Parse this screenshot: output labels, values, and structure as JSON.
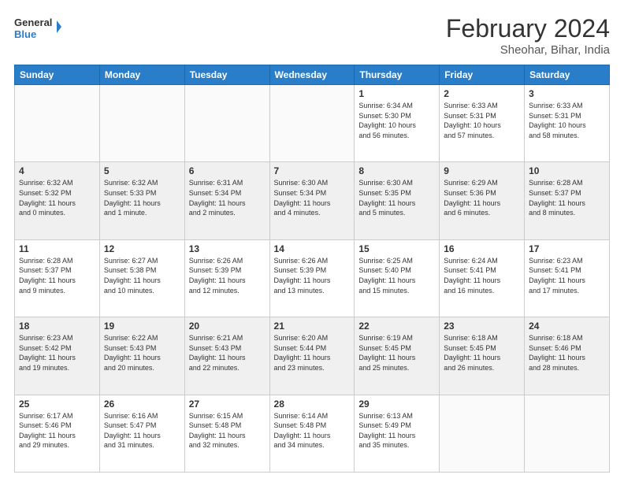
{
  "header": {
    "logo_line1": "General",
    "logo_line2": "Blue",
    "title": "February 2024",
    "subtitle": "Sheohar, Bihar, India"
  },
  "days_of_week": [
    "Sunday",
    "Monday",
    "Tuesday",
    "Wednesday",
    "Thursday",
    "Friday",
    "Saturday"
  ],
  "weeks": [
    [
      {
        "num": "",
        "info": ""
      },
      {
        "num": "",
        "info": ""
      },
      {
        "num": "",
        "info": ""
      },
      {
        "num": "",
        "info": ""
      },
      {
        "num": "1",
        "info": "Sunrise: 6:34 AM\nSunset: 5:30 PM\nDaylight: 10 hours\nand 56 minutes."
      },
      {
        "num": "2",
        "info": "Sunrise: 6:33 AM\nSunset: 5:31 PM\nDaylight: 10 hours\nand 57 minutes."
      },
      {
        "num": "3",
        "info": "Sunrise: 6:33 AM\nSunset: 5:31 PM\nDaylight: 10 hours\nand 58 minutes."
      }
    ],
    [
      {
        "num": "4",
        "info": "Sunrise: 6:32 AM\nSunset: 5:32 PM\nDaylight: 11 hours\nand 0 minutes."
      },
      {
        "num": "5",
        "info": "Sunrise: 6:32 AM\nSunset: 5:33 PM\nDaylight: 11 hours\nand 1 minute."
      },
      {
        "num": "6",
        "info": "Sunrise: 6:31 AM\nSunset: 5:34 PM\nDaylight: 11 hours\nand 2 minutes."
      },
      {
        "num": "7",
        "info": "Sunrise: 6:30 AM\nSunset: 5:34 PM\nDaylight: 11 hours\nand 4 minutes."
      },
      {
        "num": "8",
        "info": "Sunrise: 6:30 AM\nSunset: 5:35 PM\nDaylight: 11 hours\nand 5 minutes."
      },
      {
        "num": "9",
        "info": "Sunrise: 6:29 AM\nSunset: 5:36 PM\nDaylight: 11 hours\nand 6 minutes."
      },
      {
        "num": "10",
        "info": "Sunrise: 6:28 AM\nSunset: 5:37 PM\nDaylight: 11 hours\nand 8 minutes."
      }
    ],
    [
      {
        "num": "11",
        "info": "Sunrise: 6:28 AM\nSunset: 5:37 PM\nDaylight: 11 hours\nand 9 minutes."
      },
      {
        "num": "12",
        "info": "Sunrise: 6:27 AM\nSunset: 5:38 PM\nDaylight: 11 hours\nand 10 minutes."
      },
      {
        "num": "13",
        "info": "Sunrise: 6:26 AM\nSunset: 5:39 PM\nDaylight: 11 hours\nand 12 minutes."
      },
      {
        "num": "14",
        "info": "Sunrise: 6:26 AM\nSunset: 5:39 PM\nDaylight: 11 hours\nand 13 minutes."
      },
      {
        "num": "15",
        "info": "Sunrise: 6:25 AM\nSunset: 5:40 PM\nDaylight: 11 hours\nand 15 minutes."
      },
      {
        "num": "16",
        "info": "Sunrise: 6:24 AM\nSunset: 5:41 PM\nDaylight: 11 hours\nand 16 minutes."
      },
      {
        "num": "17",
        "info": "Sunrise: 6:23 AM\nSunset: 5:41 PM\nDaylight: 11 hours\nand 17 minutes."
      }
    ],
    [
      {
        "num": "18",
        "info": "Sunrise: 6:23 AM\nSunset: 5:42 PM\nDaylight: 11 hours\nand 19 minutes."
      },
      {
        "num": "19",
        "info": "Sunrise: 6:22 AM\nSunset: 5:43 PM\nDaylight: 11 hours\nand 20 minutes."
      },
      {
        "num": "20",
        "info": "Sunrise: 6:21 AM\nSunset: 5:43 PM\nDaylight: 11 hours\nand 22 minutes."
      },
      {
        "num": "21",
        "info": "Sunrise: 6:20 AM\nSunset: 5:44 PM\nDaylight: 11 hours\nand 23 minutes."
      },
      {
        "num": "22",
        "info": "Sunrise: 6:19 AM\nSunset: 5:45 PM\nDaylight: 11 hours\nand 25 minutes."
      },
      {
        "num": "23",
        "info": "Sunrise: 6:18 AM\nSunset: 5:45 PM\nDaylight: 11 hours\nand 26 minutes."
      },
      {
        "num": "24",
        "info": "Sunrise: 6:18 AM\nSunset: 5:46 PM\nDaylight: 11 hours\nand 28 minutes."
      }
    ],
    [
      {
        "num": "25",
        "info": "Sunrise: 6:17 AM\nSunset: 5:46 PM\nDaylight: 11 hours\nand 29 minutes."
      },
      {
        "num": "26",
        "info": "Sunrise: 6:16 AM\nSunset: 5:47 PM\nDaylight: 11 hours\nand 31 minutes."
      },
      {
        "num": "27",
        "info": "Sunrise: 6:15 AM\nSunset: 5:48 PM\nDaylight: 11 hours\nand 32 minutes."
      },
      {
        "num": "28",
        "info": "Sunrise: 6:14 AM\nSunset: 5:48 PM\nDaylight: 11 hours\nand 34 minutes."
      },
      {
        "num": "29",
        "info": "Sunrise: 6:13 AM\nSunset: 5:49 PM\nDaylight: 11 hours\nand 35 minutes."
      },
      {
        "num": "",
        "info": ""
      },
      {
        "num": "",
        "info": ""
      }
    ]
  ]
}
